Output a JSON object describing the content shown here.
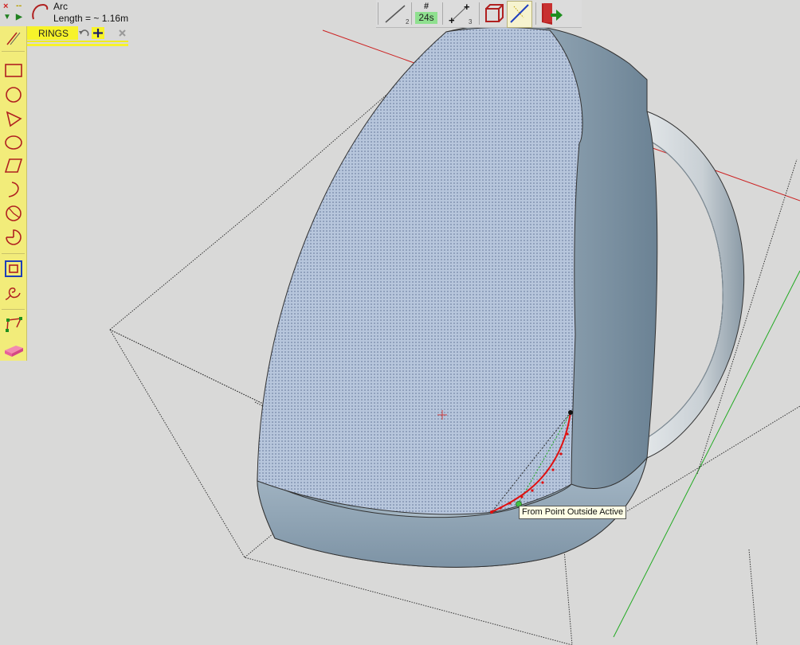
{
  "status": {
    "close_glyph": "×",
    "minus_glyph": "--",
    "down_glyph": "▼",
    "play_glyph": "▶",
    "tool_name": "Arc",
    "measurement": "Length = ~ 1.16m"
  },
  "toolbar": {
    "segments_symbol": "#",
    "segments_value": "24s"
  },
  "rings": {
    "label": "RINGS"
  },
  "tooltip": {
    "text": "From Point Outside Active"
  },
  "colors": {
    "viewport_bg": "#d9d9d8",
    "palette_bg": "#f2ec7a",
    "rings_yellow": "#f7f32a",
    "segments_green": "#8fe08f",
    "arc_red": "#e01010",
    "tool_red": "#b02020",
    "axis_red": "#cc2222",
    "axis_green": "#22aa22"
  },
  "icons": {
    "status": [
      "close-icon",
      "minimize-icon",
      "collapse-icon",
      "play-icon",
      "arc-icon"
    ],
    "toolbar": [
      "segment-line-icon",
      "segments-count-icon",
      "points-icon",
      "box-icon",
      "diagonal-line-icon",
      "exit-door-icon"
    ],
    "palette": [
      "line-tool-icon",
      "rectangle-icon",
      "circle-icon",
      "triangle-icon",
      "ellipse-icon",
      "parallelogram-icon",
      "arc-icon",
      "pie-slice-icon",
      "sector-icon",
      "offset-square-icon",
      "spiral-icon",
      "polyline-icon",
      "eraser-icon"
    ]
  }
}
